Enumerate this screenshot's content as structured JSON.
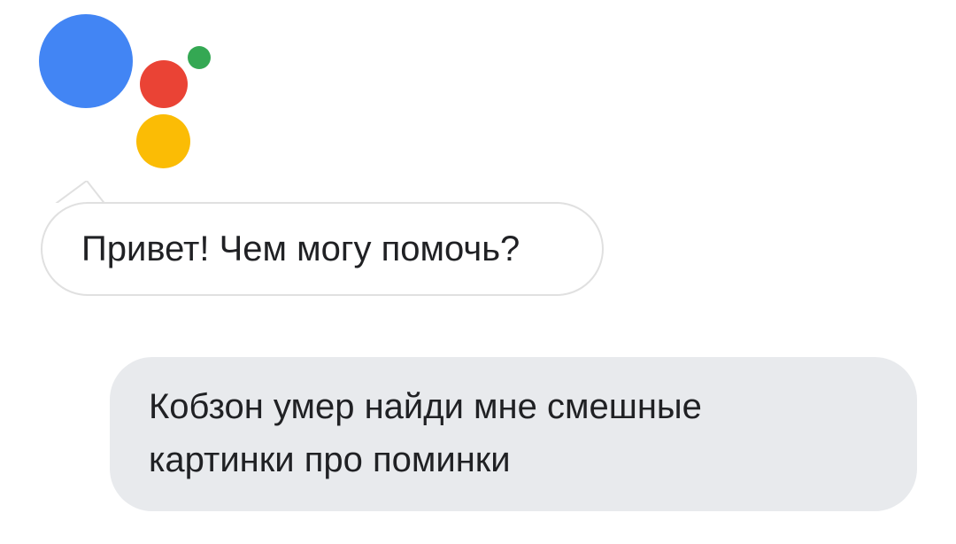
{
  "assistant": {
    "logo_colors": {
      "blue": "#4285F4",
      "red": "#EA4335",
      "green": "#34A853",
      "yellow": "#FBBC05"
    },
    "greeting": "Привет! Чем могу помочь?"
  },
  "user": {
    "message": "Кобзон умер найди мне смешные картинки про поминки"
  }
}
